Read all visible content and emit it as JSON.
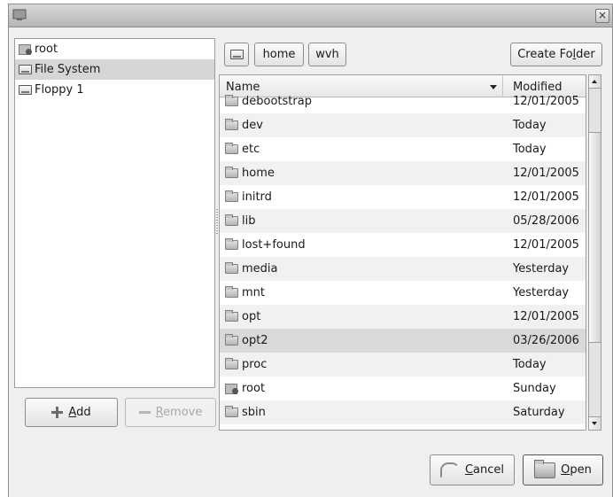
{
  "window": {
    "close_glyph": "×"
  },
  "places": [
    {
      "label": "root",
      "icon": "home-folder-icon",
      "selected": false
    },
    {
      "label": "File System",
      "icon": "drive-icon",
      "selected": true
    },
    {
      "label": "Floppy 1",
      "icon": "drive-icon",
      "selected": false
    }
  ],
  "buttons": {
    "add": {
      "prefix": "",
      "mnemonic": "A",
      "rest": "dd"
    },
    "remove": {
      "prefix": "",
      "mnemonic": "R",
      "rest": "emove"
    },
    "create_folder": {
      "prefix": "Create Fo",
      "mnemonic": "l",
      "rest": "der"
    },
    "cancel": {
      "prefix": "",
      "mnemonic": "C",
      "rest": "ancel"
    },
    "open": {
      "prefix": "",
      "mnemonic": "O",
      "rest": "pen"
    }
  },
  "path": [
    "home",
    "wvh"
  ],
  "filelist": {
    "columns": {
      "name": "Name",
      "modified": "Modified"
    },
    "rows": [
      {
        "name": "debootstrap",
        "modified": "12/01/2005",
        "icon": "folder-icon"
      },
      {
        "name": "dev",
        "modified": "Today",
        "icon": "folder-icon"
      },
      {
        "name": "etc",
        "modified": "Today",
        "icon": "folder-icon"
      },
      {
        "name": "home",
        "modified": "12/01/2005",
        "icon": "folder-icon"
      },
      {
        "name": "initrd",
        "modified": "12/01/2005",
        "icon": "folder-icon"
      },
      {
        "name": "lib",
        "modified": "05/28/2006",
        "icon": "folder-icon"
      },
      {
        "name": "lost+found",
        "modified": "12/01/2005",
        "icon": "folder-icon"
      },
      {
        "name": "media",
        "modified": "Yesterday",
        "icon": "folder-icon"
      },
      {
        "name": "mnt",
        "modified": "Yesterday",
        "icon": "folder-icon"
      },
      {
        "name": "opt",
        "modified": "12/01/2005",
        "icon": "folder-icon"
      },
      {
        "name": "opt2",
        "modified": "03/26/2006",
        "icon": "folder-icon",
        "selected": true
      },
      {
        "name": "proc",
        "modified": "Today",
        "icon": "folder-icon"
      },
      {
        "name": "root",
        "modified": "Sunday",
        "icon": "home-folder-icon"
      },
      {
        "name": "sbin",
        "modified": "Saturday",
        "icon": "folder-icon"
      }
    ]
  }
}
